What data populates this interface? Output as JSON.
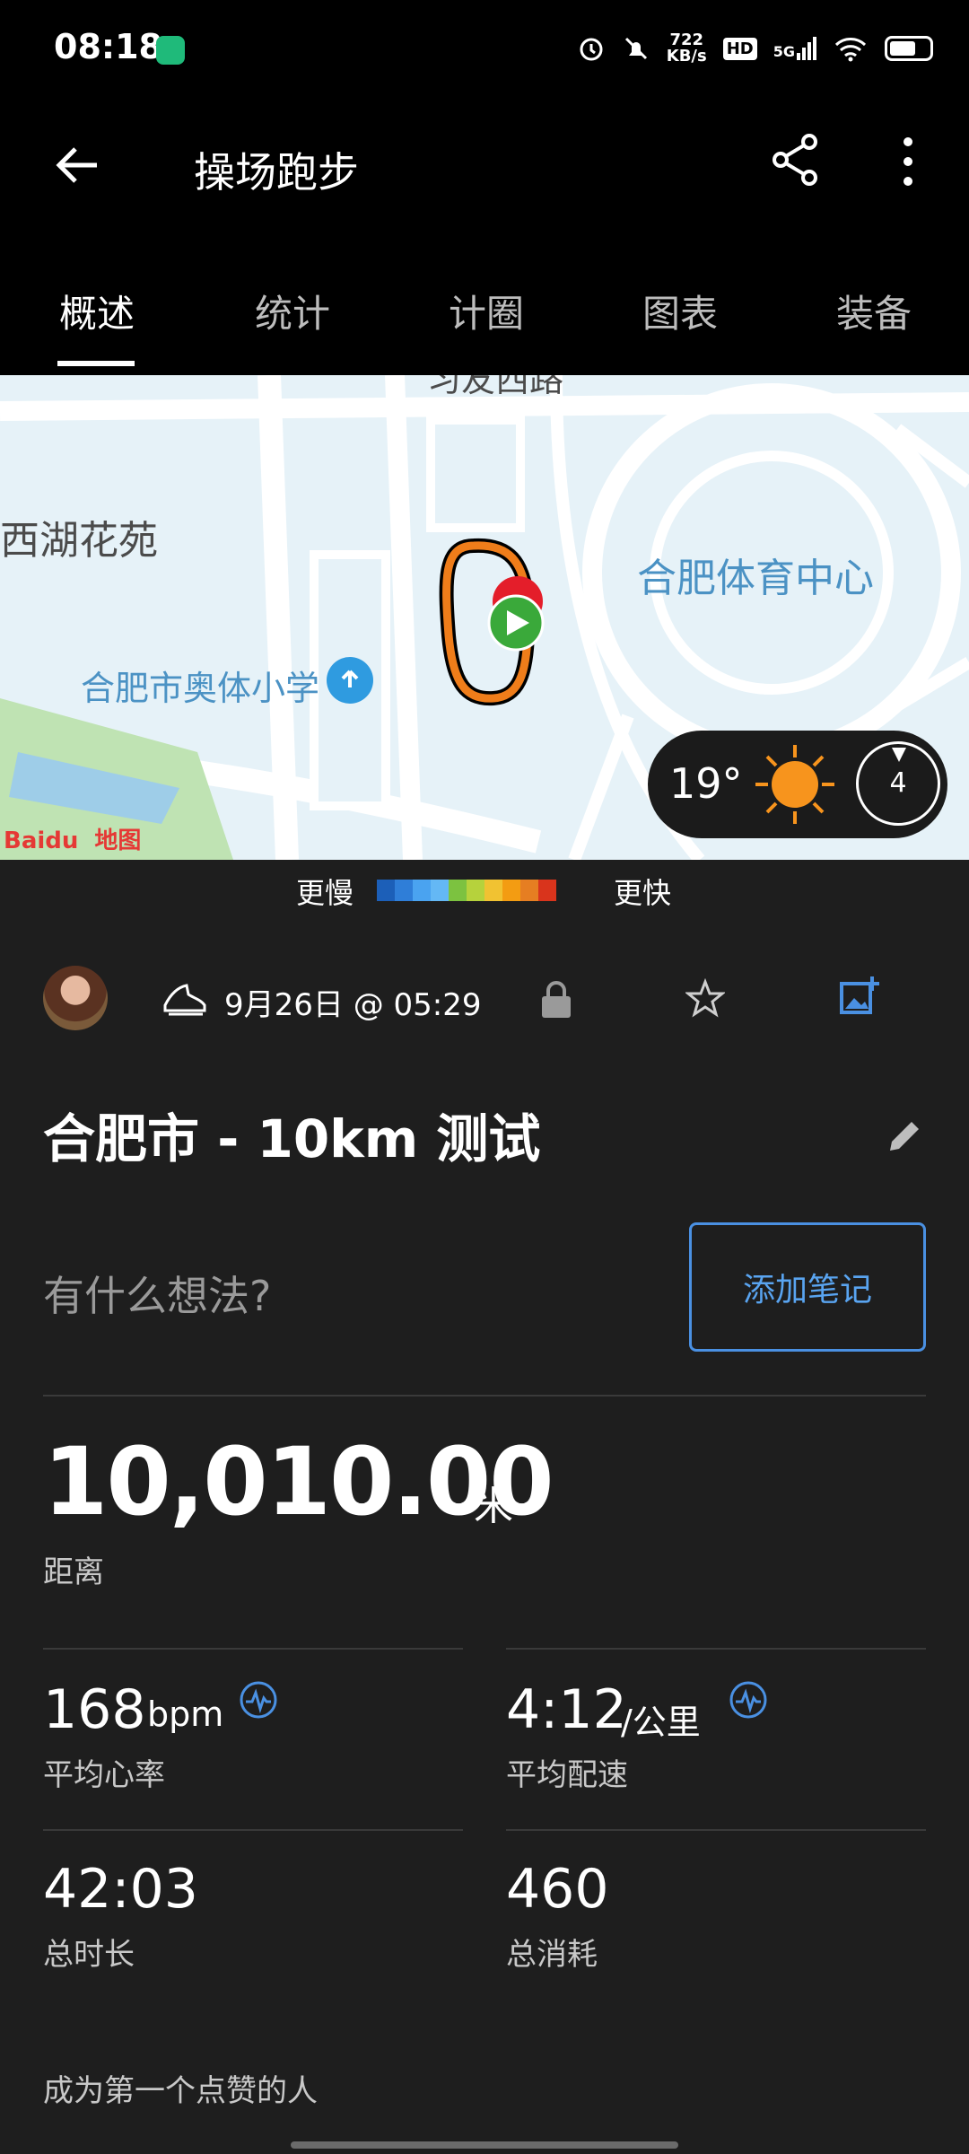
{
  "status_bar": {
    "time": "08:18",
    "net_speed_value": "722",
    "net_speed_unit": "KB/s",
    "hd_label": "HD",
    "signal_label": "5G"
  },
  "app_bar": {
    "title": "操场跑步"
  },
  "tabs": [
    {
      "label": "概述",
      "active": true
    },
    {
      "label": "统计",
      "active": false
    },
    {
      "label": "计圈",
      "active": false
    },
    {
      "label": "图表",
      "active": false
    },
    {
      "label": "装备",
      "active": false
    }
  ],
  "map": {
    "labels": {
      "road_top": "习友西路",
      "garden": "西湖花苑",
      "sports_center": "合肥体育中心",
      "school": "合肥市奥体小学",
      "baidu": "Baidu",
      "baidu_map": "地图"
    },
    "weather": {
      "temperature": "19°",
      "wind": "4"
    }
  },
  "pace_legend": {
    "slower": "更慢",
    "faster": "更快",
    "colors": [
      "#1c5fb8",
      "#2f7ed8",
      "#4aa3f0",
      "#64b8f5",
      "#7cc240",
      "#b6d23c",
      "#f1c232",
      "#f39c12",
      "#e67e22",
      "#d9341c"
    ]
  },
  "activity": {
    "datetime": "9月26日 @ 05:29",
    "name": "合肥市 - 10km 测试",
    "thought_placeholder": "有什么想法?",
    "add_note": "添加笔记"
  },
  "stats": {
    "distance": {
      "value": "10,010.00",
      "unit": "米",
      "label": "距离"
    },
    "avg_hr": {
      "value": "168",
      "unit": "bpm",
      "label": "平均心率"
    },
    "avg_pace": {
      "value": "4:12",
      "unit": "/公里",
      "label": "平均配速"
    },
    "duration": {
      "value": "42:03",
      "label": "总时长"
    },
    "calories": {
      "value": "460",
      "label": "总消耗"
    }
  },
  "social": {
    "likes_text": "成为第一个点赞的人"
  },
  "colors": {
    "accent": "#4a90e2",
    "background": "#1e1e1e",
    "header": "#000000"
  }
}
